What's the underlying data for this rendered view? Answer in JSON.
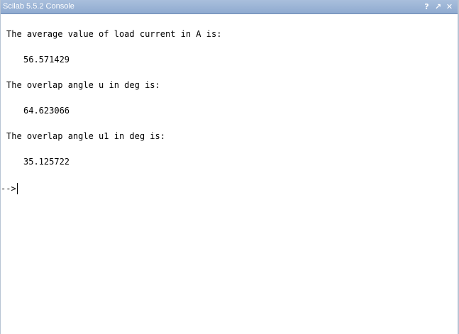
{
  "window": {
    "title": "Scilab 5.5.2 Console",
    "buttons": [
      {
        "name": "help",
        "glyph": "?"
      },
      {
        "name": "undock",
        "glyph": "↗"
      },
      {
        "name": "close",
        "glyph": "✕"
      }
    ]
  },
  "console": {
    "lines": [
      {
        "kind": "label",
        "text": "The average value of load current in A is:"
      },
      {
        "kind": "value",
        "text": "56.571429"
      },
      {
        "kind": "label",
        "text": "The overlap angle u in deg is:"
      },
      {
        "kind": "value",
        "text": "64.623066"
      },
      {
        "kind": "label",
        "text": "The overlap angle u1 in deg is:"
      },
      {
        "kind": "value",
        "text": "35.125722"
      }
    ],
    "prompt": "-->"
  }
}
